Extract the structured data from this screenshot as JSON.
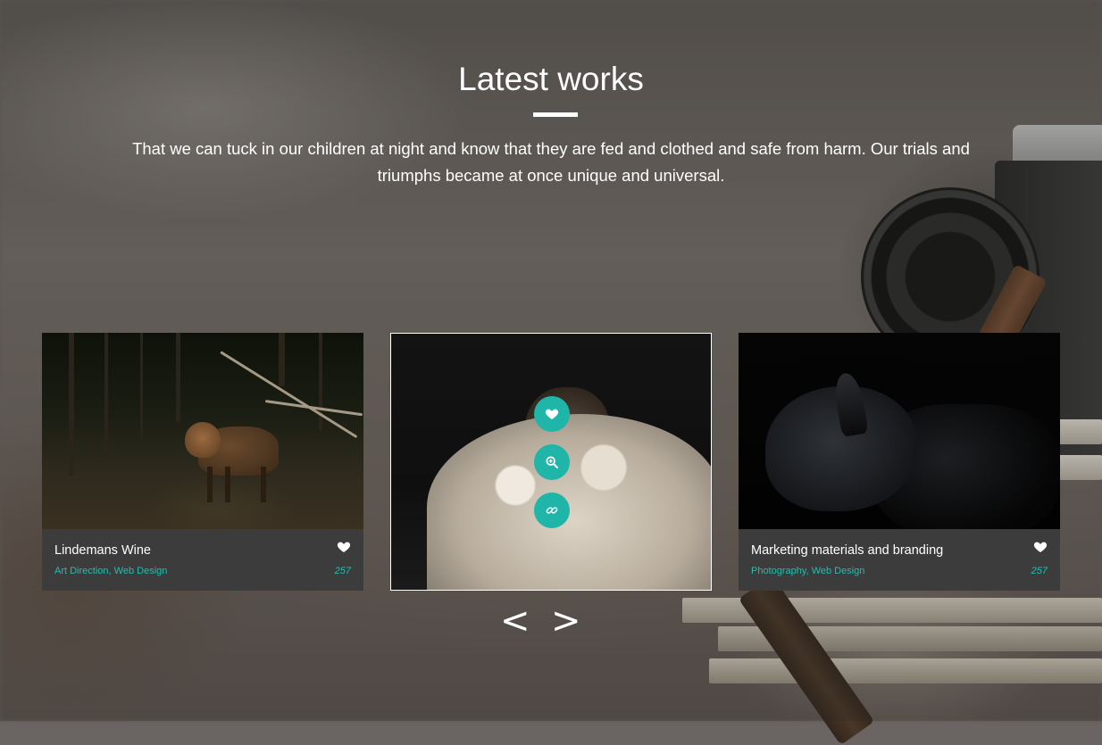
{
  "section": {
    "title": "Latest works",
    "subtitle": "That we can tuck in our children at night and know that they are fed and clothed and safe from harm. Our trials and triumphs became at once unique and universal."
  },
  "colors": {
    "accent": "#1fb5a8",
    "card_info_bg": "#3c3c3c"
  },
  "works": [
    {
      "name": "Lindemans Wine",
      "tags": [
        "Art Direction",
        "Web Design"
      ],
      "likes": "257",
      "icon": "heart-icon"
    },
    {
      "name": "",
      "tags": [],
      "likes": "",
      "hover_actions": [
        "heart-icon",
        "zoom-icon",
        "link-icon"
      ]
    },
    {
      "name": "Marketing materials and branding",
      "tags": [
        "Photography",
        "Web Design"
      ],
      "likes": "257",
      "icon": "heart-icon"
    }
  ],
  "navigation": {
    "prev_label": "<",
    "next_label": ">"
  }
}
